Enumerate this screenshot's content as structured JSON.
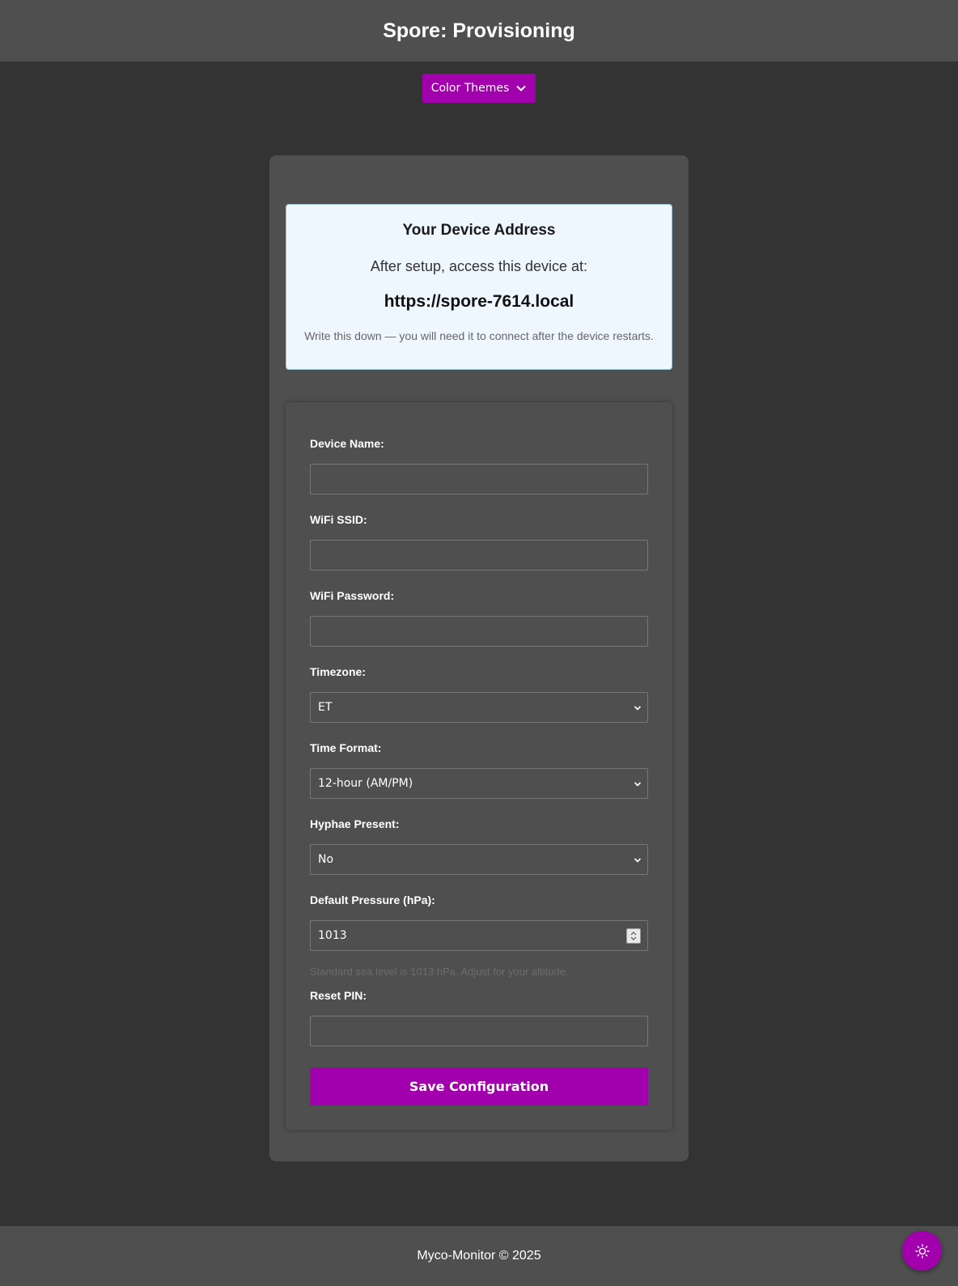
{
  "header": {
    "title": "Spore: Provisioning"
  },
  "theme_button": {
    "label": "Color Themes",
    "icon": "chevron-down-icon"
  },
  "address_box": {
    "title": "Your Device Address",
    "subtitle": "After setup, access this device at:",
    "url": "https://spore-7614.local",
    "note": "Write this down — you will need it to connect after the device restarts."
  },
  "form": {
    "device_name": {
      "label": "Device Name:",
      "value": ""
    },
    "wifi_ssid": {
      "label": "WiFi SSID:",
      "value": ""
    },
    "wifi_password": {
      "label": "WiFi Password:",
      "value": ""
    },
    "timezone": {
      "label": "Timezone:",
      "value": "ET"
    },
    "time_format": {
      "label": "Time Format:",
      "value": "12-hour (AM/PM)"
    },
    "hyphae_present": {
      "label": "Hyphae Present:",
      "value": "No"
    },
    "default_pressure": {
      "label": "Default Pressure (hPa):",
      "value": "1013",
      "hint": "Standard sea level is 1013 hPa. Adjust for your altitude."
    },
    "reset_pin": {
      "label": "Reset PIN:",
      "value": ""
    },
    "save_label": "Save Configuration"
  },
  "footer": {
    "text": "Myco-Monitor © 2025"
  },
  "fab": {
    "icon": "sun-icon"
  },
  "colors": {
    "accent": "#a300ad",
    "background": "#333333",
    "panel": "#4f4f4f",
    "address_bg": "#eef6fe"
  }
}
